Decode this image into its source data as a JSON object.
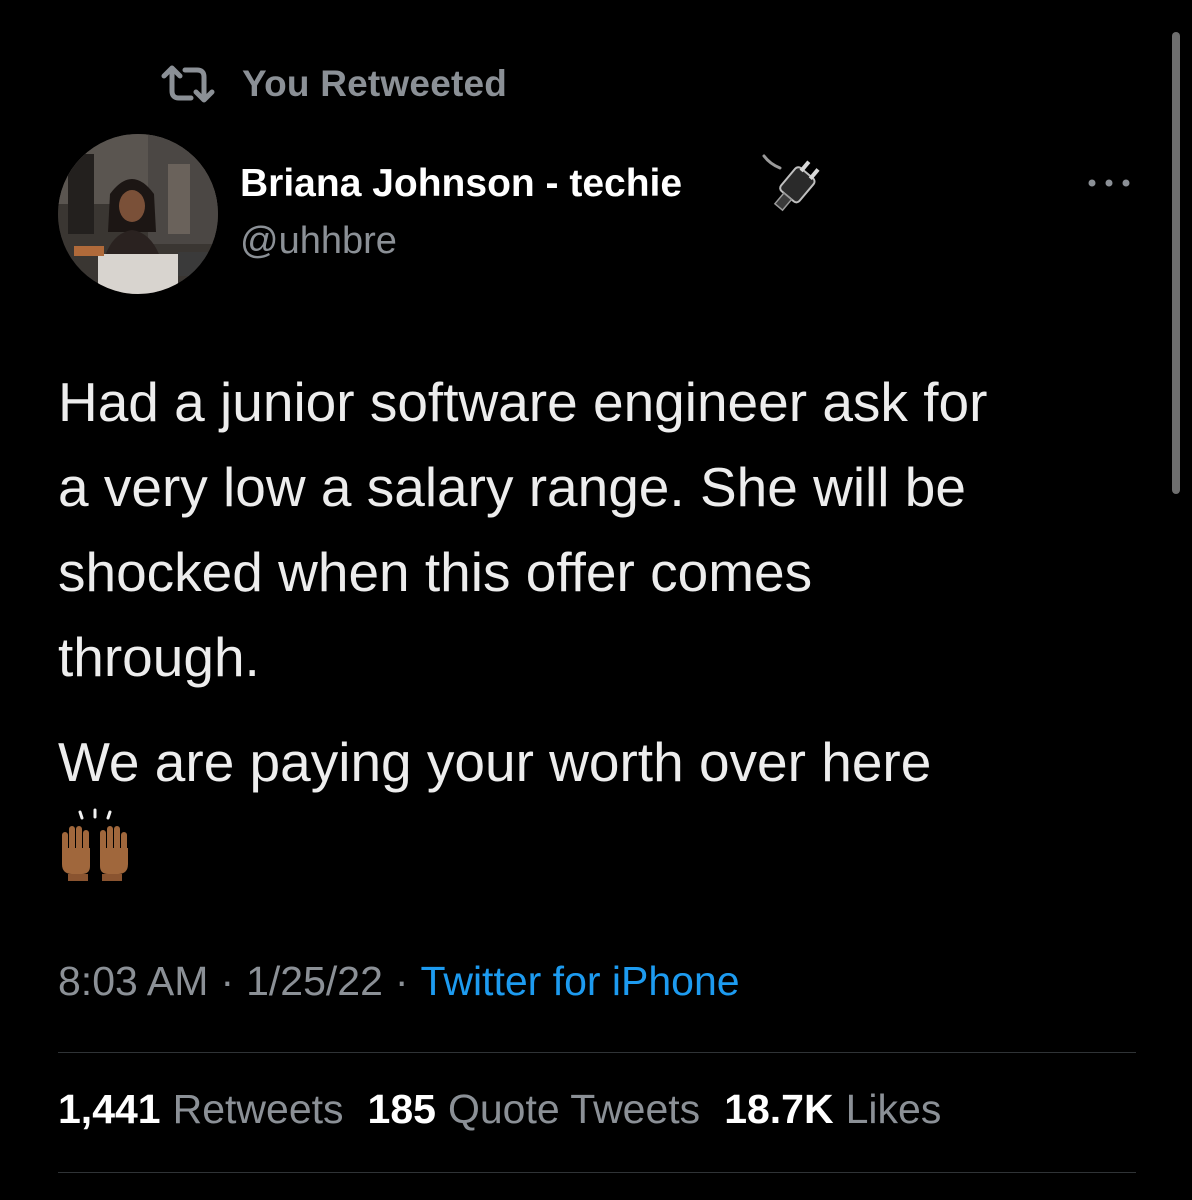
{
  "retweet_banner": {
    "label": "You Retweeted",
    "icon": "retweet-icon"
  },
  "author": {
    "display_name": "Briana Johnson - techie",
    "name_emoji_icon": "electric-plug-icon",
    "handle": "@uhhbre",
    "avatar": "profile-photo"
  },
  "menu": {
    "icon": "more-options-icon"
  },
  "tweet": {
    "lines": [
      "Had a junior software engineer ask for",
      "a very low a salary range. She will be",
      "shocked when this offer comes",
      "through."
    ],
    "paragraph_2": "We are paying your worth over here",
    "emoji_icon": "raising-hands-icon"
  },
  "meta": {
    "time": "8:03 AM",
    "separator": "·",
    "date": "1/25/22",
    "source": "Twitter for iPhone"
  },
  "stats": {
    "retweets": {
      "count": "1,441",
      "label": "Retweets"
    },
    "quotes": {
      "count": "185",
      "label": "Quote Tweets"
    },
    "likes": {
      "count": "18.7K",
      "label": "Likes"
    }
  },
  "colors": {
    "background": "#000000",
    "primary_text": "#e7e9ea",
    "secondary_text": "#8b9096",
    "link": "#1d9bf0",
    "divider": "#2f3336"
  }
}
